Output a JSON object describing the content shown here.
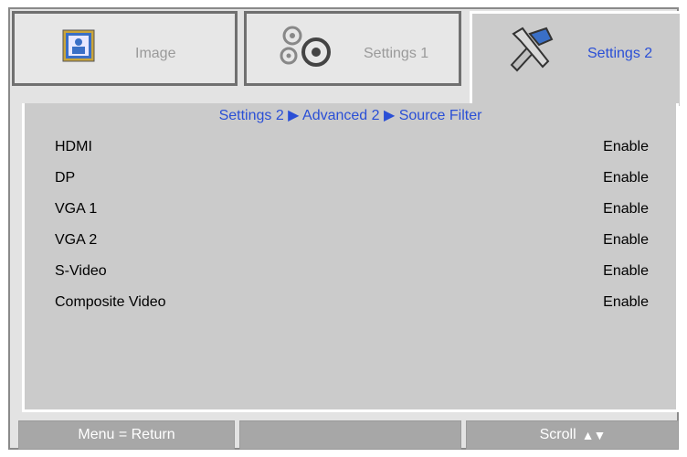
{
  "tabs": [
    {
      "label": "Image",
      "icon": "image-icon",
      "active": false
    },
    {
      "label": "Settings 1",
      "icon": "gears-icon",
      "active": false
    },
    {
      "label": "Settings 2",
      "icon": "tools-icon",
      "active": true
    }
  ],
  "breadcrumb": "Settings 2 ▶ Advanced 2 ▶ Source Filter",
  "rows": [
    {
      "label": "HDMI",
      "value": "Enable"
    },
    {
      "label": "DP",
      "value": "Enable"
    },
    {
      "label": "VGA 1",
      "value": "Enable"
    },
    {
      "label": "VGA 2",
      "value": "Enable"
    },
    {
      "label": "S-Video",
      "value": "Enable"
    },
    {
      "label": "Composite Video",
      "value": "Enable"
    }
  ],
  "footer": {
    "left": "Menu = Return",
    "middle": "",
    "right": "Scroll",
    "right_icon": "up-down-arrows-icon"
  },
  "colors": {
    "accent": "#2a4fd6",
    "panel": "#cbcbcb",
    "footer": "#a7a7a7"
  }
}
